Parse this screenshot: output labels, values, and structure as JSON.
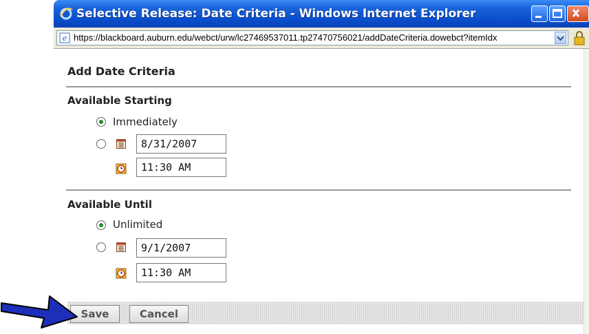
{
  "window": {
    "title": "Selective Release: Date Criteria - Windows Internet Explorer",
    "address": "https://blackboard.auburn.edu/webct/urw/lc27469537011.tp27470756021/addDateCriteria.dowebct?itemIdx"
  },
  "page": {
    "title": "Add Date Criteria",
    "available_starting": {
      "heading": "Available Starting",
      "option_immediately": "Immediately",
      "date_value": "8/31/2007",
      "time_value": "11:30 AM",
      "selected": "Immediately"
    },
    "available_until": {
      "heading": "Available Until",
      "option_unlimited": "Unlimited",
      "date_value": "9/1/2007",
      "time_value": "11:30 AM",
      "selected": "Unlimited"
    },
    "buttons": {
      "save": "Save",
      "cancel": "Cancel"
    }
  },
  "colors": {
    "titlebar": "#0a4fce",
    "radio_selected": "#2a8a2a",
    "arrow": "#1d2fb8"
  },
  "icons": [
    "ie-logo-icon",
    "page-icon",
    "dropdown-arrow-icon",
    "lock-icon",
    "calendar-icon",
    "clock-icon",
    "arrow-pointer-icon",
    "minimize-icon",
    "maximize-icon",
    "close-icon"
  ]
}
